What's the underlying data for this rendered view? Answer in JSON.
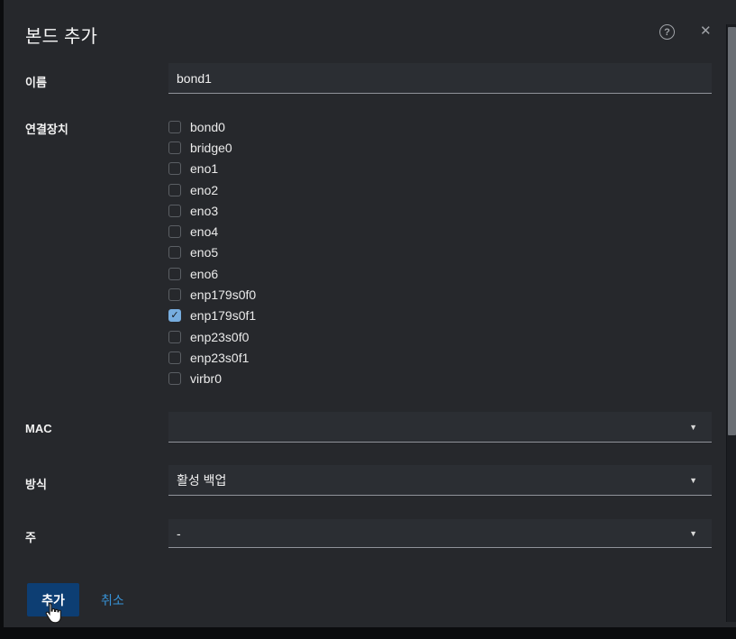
{
  "dialog": {
    "title": "본드 추가",
    "help_icon": "?",
    "close_icon": "✕"
  },
  "icons": {
    "check": "✓",
    "caret": "▼"
  },
  "fields": {
    "name": {
      "label": "이름",
      "value": "bond1"
    },
    "interfaces": {
      "label": "연결장치",
      "options": [
        {
          "label": "bond0",
          "checked": false
        },
        {
          "label": "bridge0",
          "checked": false
        },
        {
          "label": "eno1",
          "checked": false
        },
        {
          "label": "eno2",
          "checked": false
        },
        {
          "label": "eno3",
          "checked": false
        },
        {
          "label": "eno4",
          "checked": false
        },
        {
          "label": "eno5",
          "checked": false
        },
        {
          "label": "eno6",
          "checked": false
        },
        {
          "label": "enp179s0f0",
          "checked": false
        },
        {
          "label": "enp179s0f1",
          "checked": true
        },
        {
          "label": "enp23s0f0",
          "checked": false
        },
        {
          "label": "enp23s0f1",
          "checked": false
        },
        {
          "label": "virbr0",
          "checked": false
        }
      ]
    },
    "mac": {
      "label": "MAC",
      "value": ""
    },
    "mode": {
      "label": "방식",
      "value": "활성 백업"
    },
    "primary": {
      "label": "주",
      "value": "-"
    }
  },
  "footer": {
    "add_label": "추가",
    "cancel_label": "취소"
  },
  "colors": {
    "dialog_bg": "#26282c",
    "input_bg": "#2b2e33",
    "primary_button": "#0d3e73",
    "link": "#3793d8",
    "checkbox_checked": "#77addf"
  }
}
